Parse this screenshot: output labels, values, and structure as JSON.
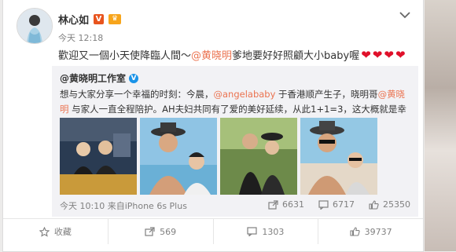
{
  "post": {
    "author": "林心如",
    "vip_badge": "V",
    "time": "今天 12:18",
    "text_before": "歡迎又一個小天使降臨人間～",
    "mention": "@黄晓明",
    "text_after": " 爹地要好好照顧大小baby喔",
    "hearts": [
      "❤",
      "❤",
      "❤",
      "❤"
    ]
  },
  "repost": {
    "author": "@黄晓明工作室",
    "verified_badge": "V",
    "text_1": "想与大家分享一个幸福的时刻：今晨，",
    "mention_1": "@angelababy",
    "text_2": " 于香港顺产生子，晓明哥",
    "mention_2": "@黄晓明",
    "text_3": " 与家人一直全程陪护。AH夫妇共同有了爱的美好延续，从此1+1=3，这大概就是幸福的模样吧",
    "heart": "❤",
    "meta": "今天 10:10 来自iPhone 6s Plus",
    "stats": {
      "reposts": "6631",
      "comments": "6717",
      "likes": "25350"
    }
  },
  "actions": {
    "favorite": "收藏",
    "repost": "569",
    "comment": "1303",
    "like": "39737"
  },
  "colors": {
    "mention": "#eb7350",
    "heart": "#e0102a",
    "repost_bg": "#f2f2f5"
  }
}
